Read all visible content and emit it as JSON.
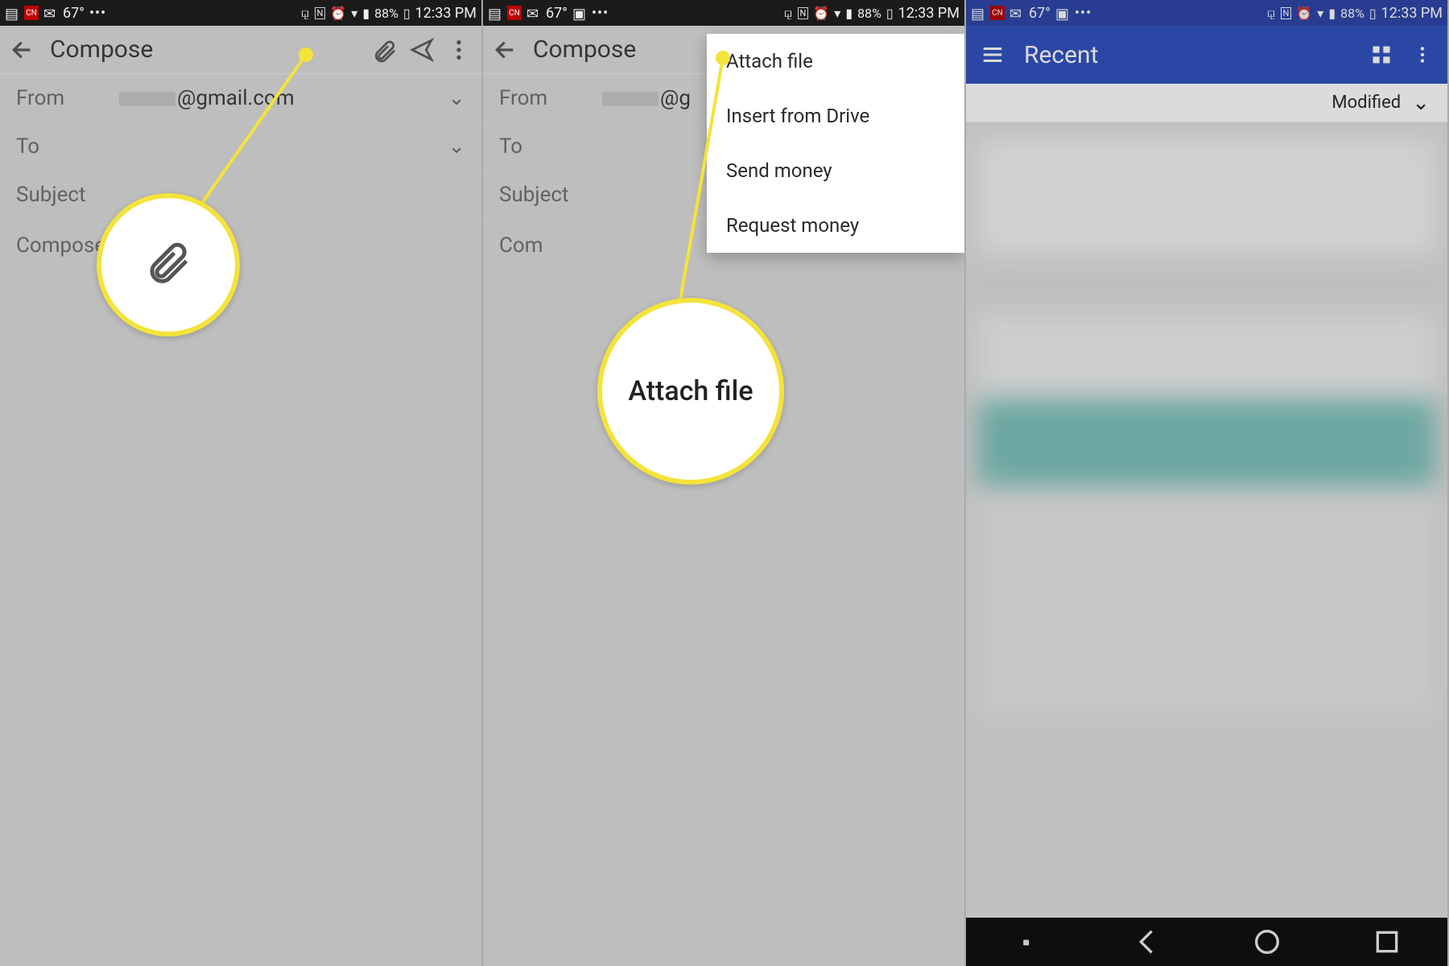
{
  "statusbar": {
    "temp": "67°",
    "battery": "88%",
    "time": "12:33 PM"
  },
  "compose": {
    "title": "Compose",
    "from_label": "From",
    "from_value": "@gmail.com",
    "to_label": "To",
    "subject_label": "Subject",
    "body_placeholder": "Compose"
  },
  "menu": {
    "items": [
      "Attach file",
      "Insert from Drive",
      "Send money",
      "Request money"
    ]
  },
  "callouts": {
    "attach_icon_label": "attach-icon",
    "attach_text": "Attach file"
  },
  "recent": {
    "title": "Recent",
    "sort_label": "Modified"
  }
}
